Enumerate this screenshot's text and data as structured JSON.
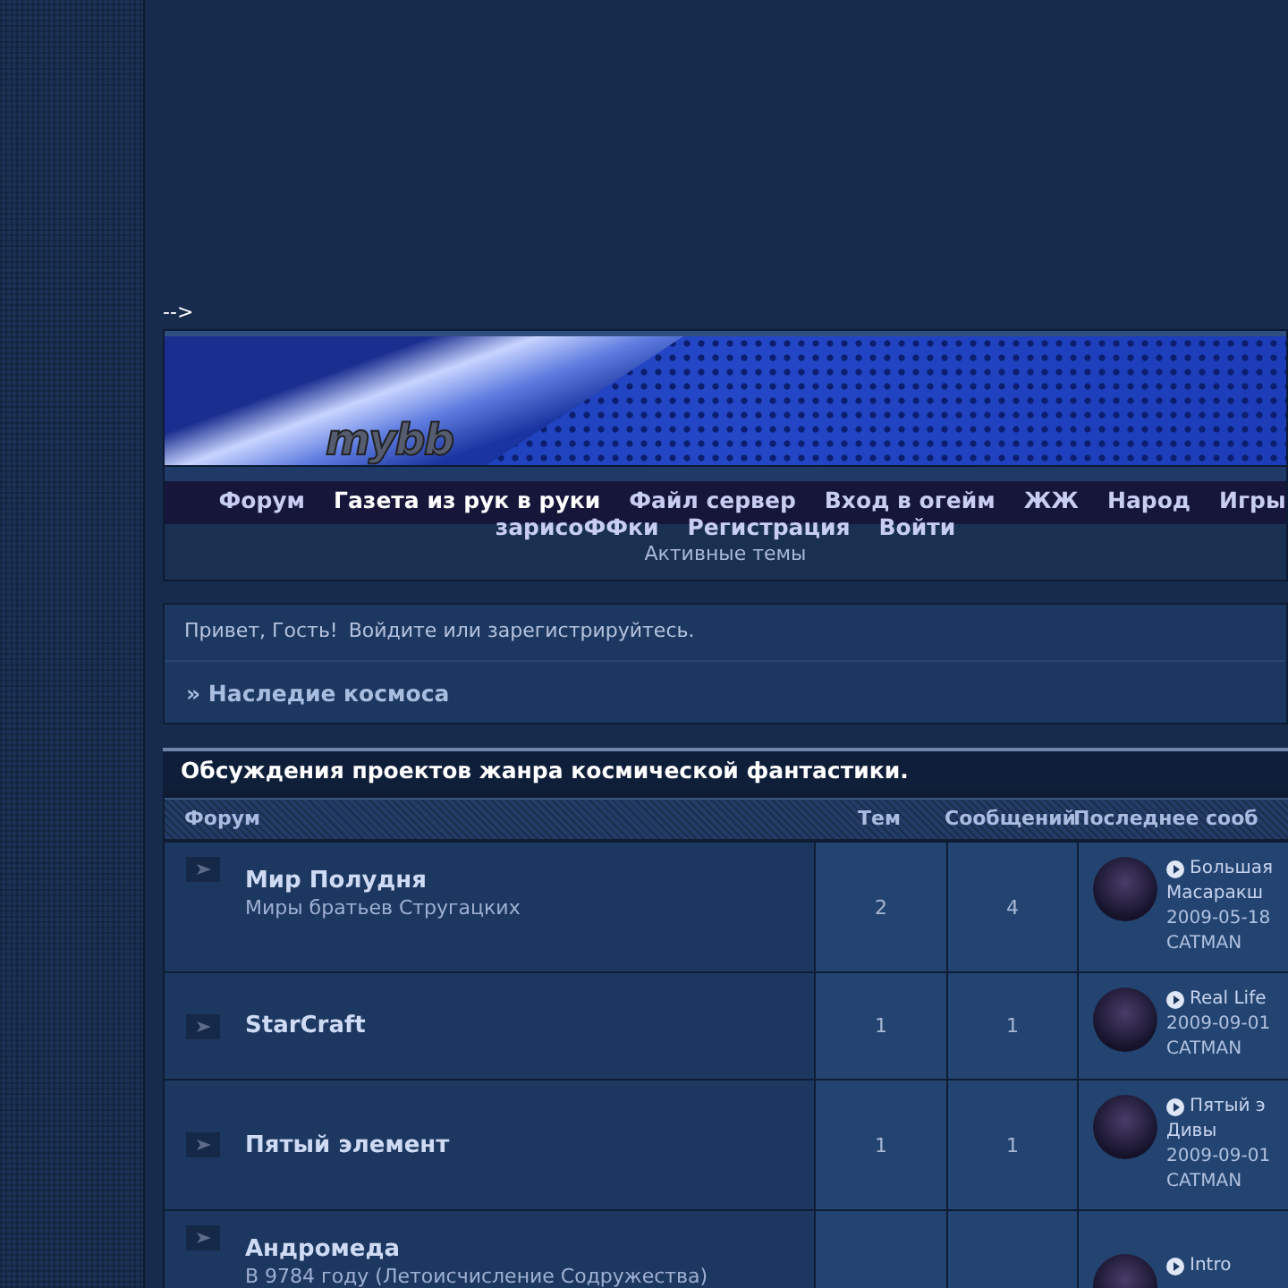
{
  "stray_text": "-->",
  "header": {
    "logo": "mybb"
  },
  "nav": {
    "lines": [
      {
        "links": [
          {
            "label": "Форум",
            "highlighted": false
          },
          {
            "label": "Газета из рук в руки",
            "highlighted": true
          },
          {
            "label": "Файл сервер",
            "highlighted": false
          },
          {
            "label": "Вход в огейм",
            "highlighted": false
          },
          {
            "label": "ЖЖ",
            "highlighted": false
          },
          {
            "label": "Народ",
            "highlighted": false
          },
          {
            "label": "Игры",
            "highlighted": false
          }
        ]
      },
      {
        "links": [
          {
            "label": "зарисоФФки",
            "highlighted": false
          },
          {
            "label": "Регистрация",
            "highlighted": false
          },
          {
            "label": "Войти",
            "highlighted": false
          }
        ]
      }
    ],
    "sub_link": "Активные темы"
  },
  "welcome": {
    "greeting": "Привет, Гость!",
    "prompt": "Войдите или зарегистрируйтесь."
  },
  "breadcrumb": "» Наследие космоса",
  "category": {
    "title": "Обсуждения проектов жанра космической фантастики.",
    "columns": [
      "Форум",
      "Тем",
      "Сообщений",
      "Последнее сооб"
    ],
    "rows": [
      {
        "name": "Мир Полудня",
        "description": "Миры братьев Стругацких",
        "topics": "2",
        "posts": "4",
        "last_post": {
          "topic_lines": [
            "Большая",
            "Масаракш"
          ],
          "date": "2009-05-18",
          "author": "CATMAN"
        }
      },
      {
        "name": "StarCraft",
        "topics": "1",
        "posts": "1",
        "last_post": {
          "topic_lines": [
            "Real Life"
          ],
          "date": "2009-09-01",
          "author": "CATMAN"
        }
      },
      {
        "name": "Пятый элемент",
        "topics": "1",
        "posts": "1",
        "last_post": {
          "topic_lines": [
            "Пятый э",
            "Дивы"
          ],
          "date": "2009-09-01",
          "author": "CATMAN"
        }
      },
      {
        "name": "Андромеда",
        "description": "В 9784 году (Летоисчисление Содружества)",
        "last_post": {
          "topic_lines": [
            "Intro"
          ]
        }
      }
    ]
  }
}
